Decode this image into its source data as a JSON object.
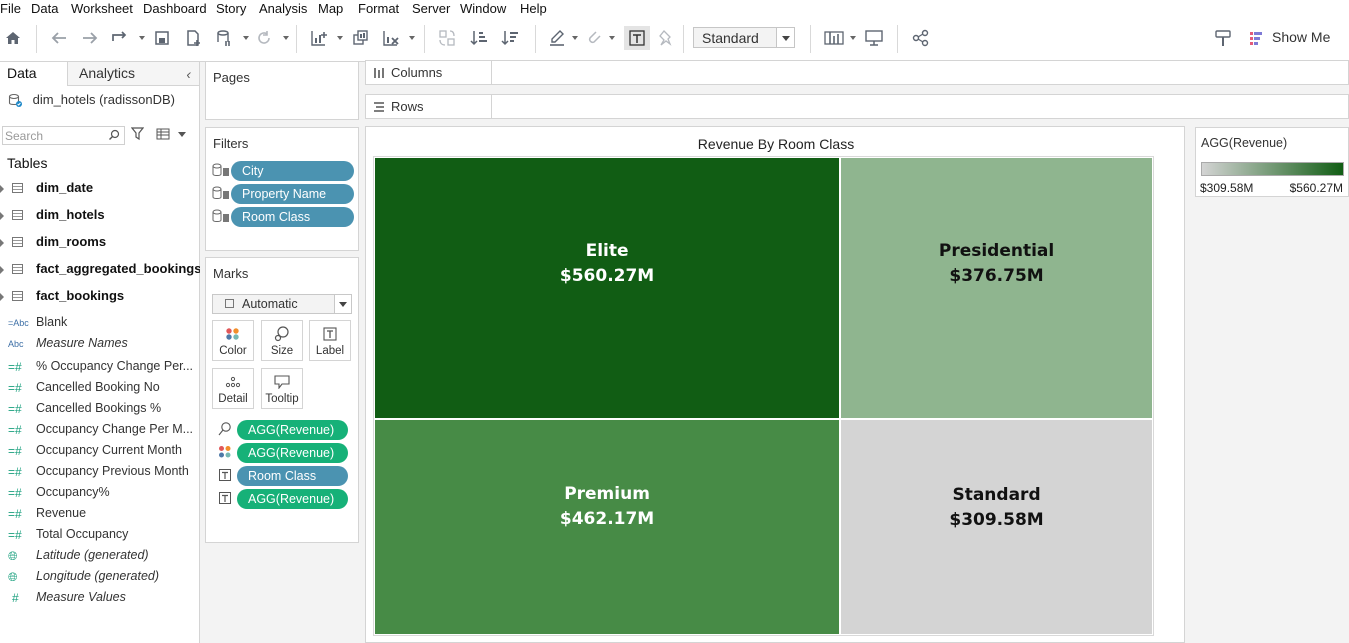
{
  "menu": [
    "File",
    "Data",
    "Worksheet",
    "Dashboard",
    "Story",
    "Analysis",
    "Map",
    "Format",
    "Server",
    "Window",
    "Help"
  ],
  "toolbar": {
    "fit_select": "Standard",
    "show_me": "Show Me"
  },
  "data_pane": {
    "tab_data": "Data",
    "tab_analytics": "Analytics",
    "datasource": "dim_hotels (radissonDB)",
    "search_placeholder": "Search",
    "tables_heading": "Tables",
    "tables": [
      "dim_date",
      "dim_hotels",
      "dim_rooms",
      "fact_aggregated_bookings",
      "fact_bookings"
    ],
    "fields": [
      {
        "label": "Blank",
        "type": "abc",
        "italic": false
      },
      {
        "label": "Measure Names",
        "type": "abc",
        "italic": true
      },
      {
        "label": "% Occupancy Change Per...",
        "type": "calc",
        "italic": false
      },
      {
        "label": "Cancelled Booking No",
        "type": "calc",
        "italic": false
      },
      {
        "label": "Cancelled Bookings %",
        "type": "calc",
        "italic": false
      },
      {
        "label": "Occupancy Change Per M...",
        "type": "calc",
        "italic": false
      },
      {
        "label": "Occupancy Current Month",
        "type": "calc",
        "italic": false
      },
      {
        "label": "Occupancy Previous Month",
        "type": "calc",
        "italic": false
      },
      {
        "label": "Occupancy%",
        "type": "calc",
        "italic": false
      },
      {
        "label": "Revenue",
        "type": "calc",
        "italic": false
      },
      {
        "label": "Total Occupancy",
        "type": "calc",
        "italic": false
      },
      {
        "label": "Latitude (generated)",
        "type": "geo",
        "italic": true
      },
      {
        "label": "Longitude (generated)",
        "type": "geo",
        "italic": true
      },
      {
        "label": "Measure Values",
        "type": "num",
        "italic": true
      }
    ]
  },
  "pages": {
    "title": "Pages"
  },
  "filters": {
    "title": "Filters",
    "items": [
      "City",
      "Property Name",
      "Room Class"
    ]
  },
  "marks": {
    "title": "Marks",
    "type": "Automatic",
    "buttons": [
      "Color",
      "Size",
      "Label",
      "Detail",
      "Tooltip"
    ],
    "pills": [
      {
        "icon": "size",
        "label": "AGG(Revenue)",
        "kind": "meas"
      },
      {
        "icon": "color",
        "label": "AGG(Revenue)",
        "kind": "meas"
      },
      {
        "icon": "label",
        "label": "Room Class",
        "kind": "dim"
      },
      {
        "icon": "label",
        "label": "AGG(Revenue)",
        "kind": "meas"
      }
    ]
  },
  "shelves": {
    "columns": "Columns",
    "rows": "Rows"
  },
  "chart_data": {
    "type": "treemap",
    "title": "Revenue By Room Class",
    "measure": "AGG(Revenue)",
    "categories": [
      "Elite",
      "Presidential",
      "Premium",
      "Standard"
    ],
    "values": [
      560.27,
      376.75,
      462.17,
      309.58
    ],
    "labels": [
      "$560.27M",
      "$376.75M",
      "$462.17M",
      "$309.58M"
    ],
    "colors": [
      "#115d14",
      "#8fb58f",
      "#478b46",
      "#d4d4d4"
    ],
    "text_colors": [
      "#ffffff",
      "#111111",
      "#ffffff",
      "#111111"
    ],
    "color_range": [
      "#d4d4d4",
      "#115d14"
    ]
  },
  "legend": {
    "title": "AGG(Revenue)",
    "min": "$309.58M",
    "max": "$560.27M"
  }
}
